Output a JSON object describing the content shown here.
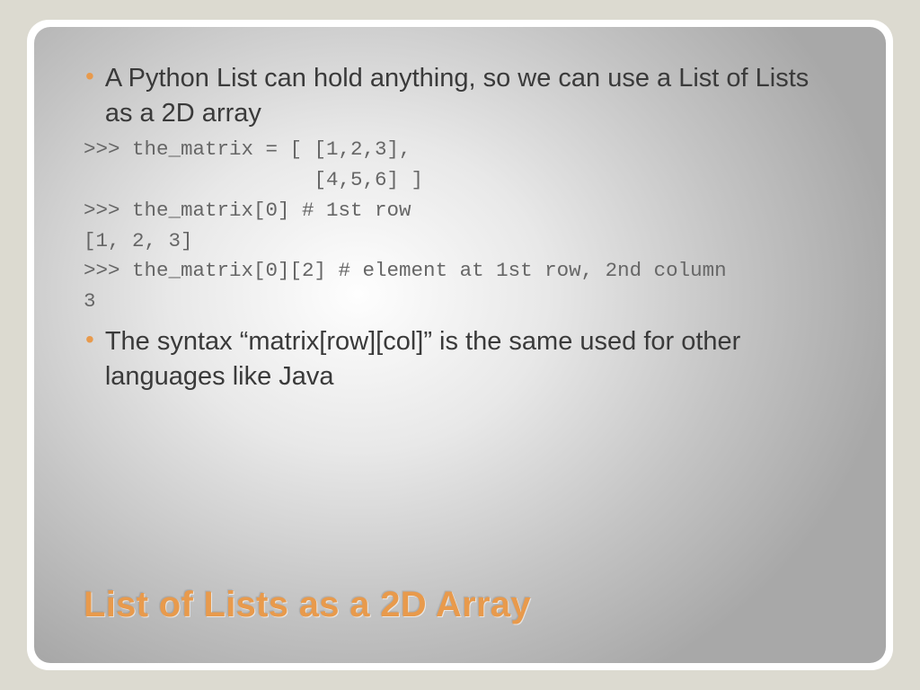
{
  "bullets": {
    "item1": "A Python List can hold anything, so we can use a List of Lists as a 2D array",
    "item2": "The syntax “matrix[row][col]” is the same used for other languages like Java"
  },
  "code": {
    "line1": ">>> the_matrix = [ [1,2,3],",
    "line2": "                   [4,5,6] ]",
    "line3": ">>> the_matrix[0] # 1st row",
    "line4": "[1, 2, 3]",
    "line5": ">>> the_matrix[0][2] # element at 1st row, 2nd column",
    "line6": "3"
  },
  "title": "List of Lists as a 2D Array"
}
